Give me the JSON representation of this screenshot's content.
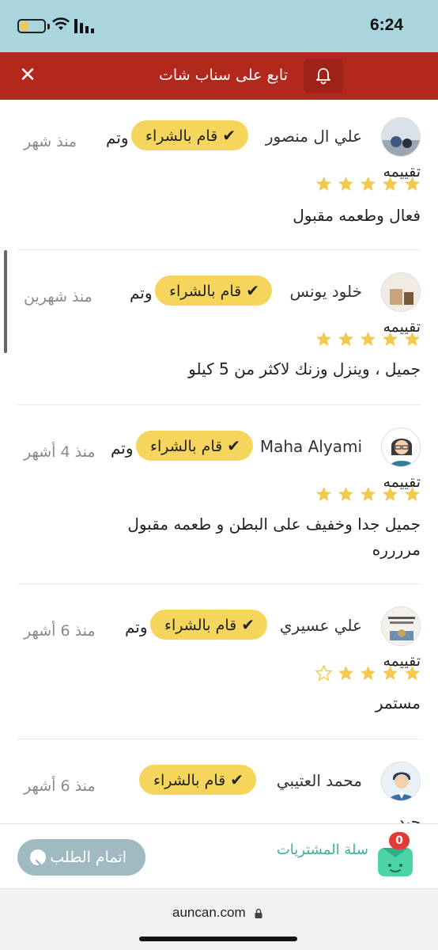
{
  "status_bar": {
    "time": "6:24"
  },
  "header": {
    "title": "تابع على سناب شات"
  },
  "badge_label": "قام بالشراء",
  "done_word": "وتم",
  "rating_label": "تقييمه",
  "colors": {
    "header_bg": "#b3281d",
    "status_bg": "#a9d6dd",
    "badge_bg": "#f6d55c",
    "star": "#f2c94c",
    "checkout_bg": "#9fbac0",
    "cart_accent": "#3bb39b"
  },
  "reviews": [
    {
      "name": "علي ال منصور",
      "time": "منذ شهر",
      "rating": 5,
      "text": "فعال وطعمه مقبول"
    },
    {
      "name": "خلود يونس",
      "time": "منذ شهرين",
      "rating": 5,
      "text": "جميل ، وينزل وزنك لاكثر من 5 كيلو"
    },
    {
      "name": "Maha Alyami",
      "time": "منذ 4 أشهر",
      "rating": 5,
      "text": "جميل جدا وخفيف على البطن و طعمه مقبول مرررره"
    },
    {
      "name": "علي عسيري",
      "time": "منذ 6 أشهر",
      "rating": 4,
      "text": "مستمر"
    },
    {
      "name": "محمد العتيبي",
      "time": "منذ 6 أشهر",
      "rating": null,
      "text": "جيد"
    }
  ],
  "cart": {
    "label": "سلة المشتريات",
    "count": "0",
    "checkout_label": "اتمام الطلب"
  },
  "browser": {
    "url": "auncan.com"
  }
}
